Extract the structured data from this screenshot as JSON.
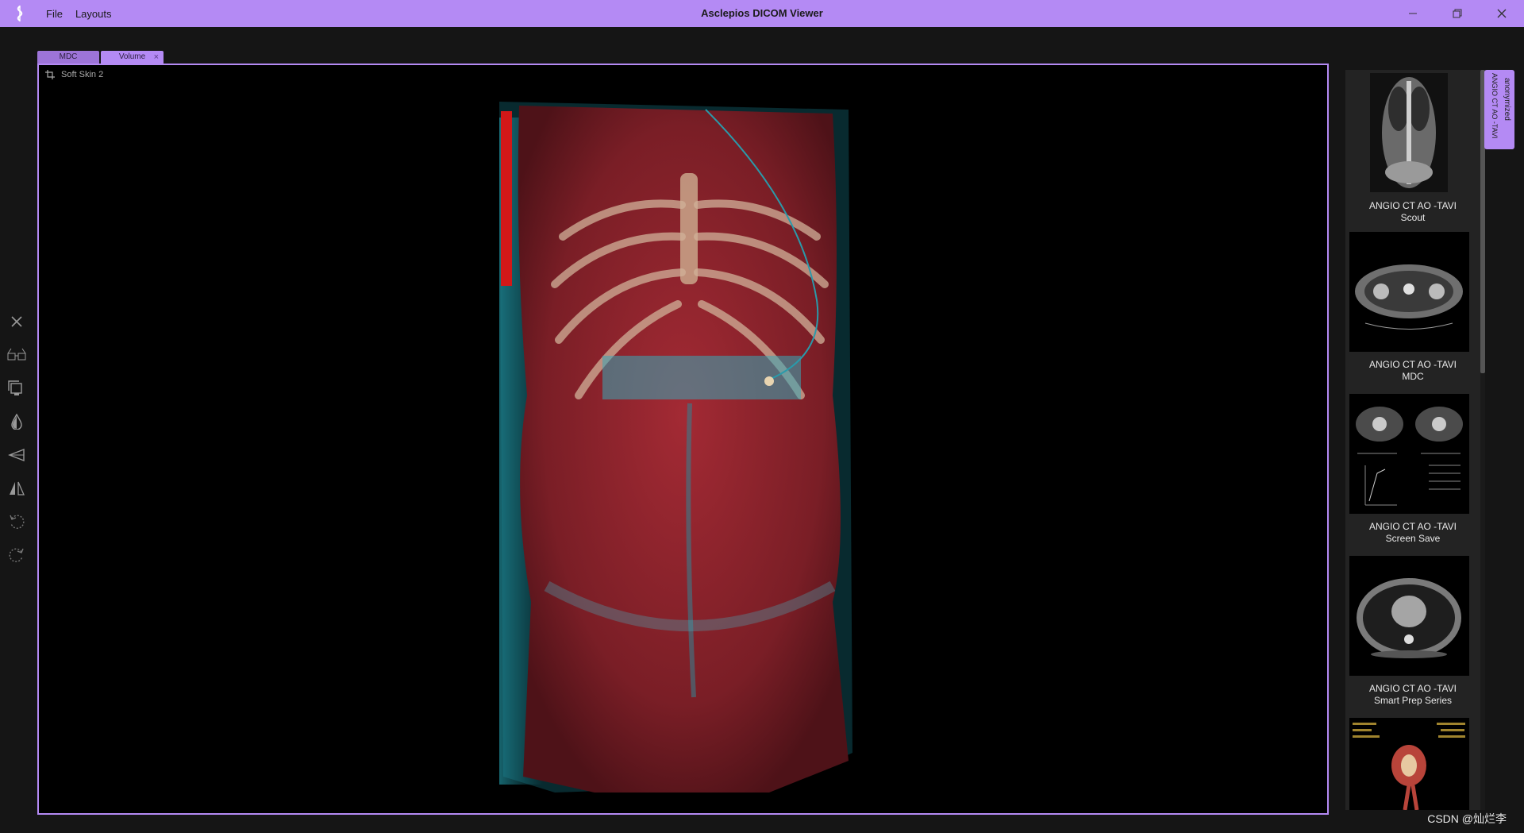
{
  "window": {
    "title": "Asclepios DICOM Viewer",
    "menu": [
      "File",
      "Layouts"
    ],
    "controls": [
      "minimize-icon",
      "restore-icon",
      "close-icon"
    ]
  },
  "tabs": [
    {
      "label": "MDC",
      "active": false
    },
    {
      "label": "Volume",
      "active": true,
      "close": "×"
    }
  ],
  "viewport": {
    "preset_label": "Soft Skin 2",
    "preset_icon": "crop-icon",
    "image": "3d-volume-render-torso"
  },
  "toolbar": {
    "icons": [
      "close-icon",
      "stereo-glasses-icon",
      "copy-layers-icon",
      "opacity-drop-icon",
      "cut-plane-icon",
      "flip-icon",
      "rotate-left-icon",
      "rotate-right-icon"
    ]
  },
  "series": [
    {
      "study": "ANGIO CT AO -TAVI",
      "name": "Scout"
    },
    {
      "study": "ANGIO CT AO -TAVI",
      "name": "MDC"
    },
    {
      "study": "ANGIO CT AO -TAVI",
      "name": "Screen Save"
    },
    {
      "study": "ANGIO CT AO -TAVI",
      "name": "Smart Prep Series"
    },
    {
      "study": "",
      "name": ""
    }
  ],
  "patient_tab": {
    "line1": "anonymized",
    "line2": "ANGIO CT AO -TAVI"
  },
  "watermark": "CSDN @灿烂李",
  "colors": {
    "accent": "#b48af4",
    "background": "#151515",
    "panel": "#232323"
  }
}
